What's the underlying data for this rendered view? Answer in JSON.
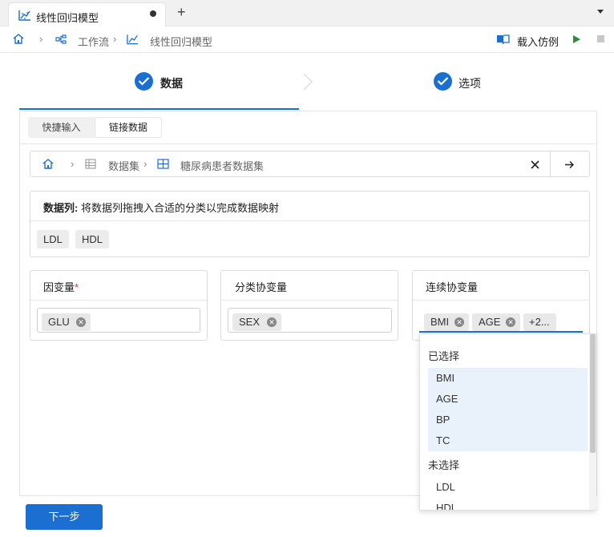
{
  "tab": {
    "title": "线性回归模型",
    "new_tab": "+"
  },
  "breadcrumb": {
    "workflow": "工作流",
    "model": "线性回归模型",
    "sep": "›",
    "load_example": "载入仿例"
  },
  "steps": [
    {
      "label": "数据"
    },
    {
      "label": "选项"
    }
  ],
  "segment": {
    "quick_input": "快捷输入",
    "link_data": "链接数据"
  },
  "path": {
    "sep": "›",
    "datasets": "数据集",
    "dataset_name": "糖尿病患者数据集"
  },
  "data_columns": {
    "title_bold": "数据列:",
    "title_rest": " 将数据列拖拽入合适的分类以完成数据映射",
    "items": [
      "LDL",
      "HDL"
    ]
  },
  "cards": {
    "dependent": {
      "title": "因变量",
      "required_mark": "*",
      "tags": [
        "GLU"
      ]
    },
    "categorical": {
      "title": "分类协变量",
      "tags": [
        "SEX"
      ]
    },
    "continuous": {
      "title": "连续协变量",
      "tags": [
        "BMI",
        "AGE"
      ],
      "more": "+2..."
    }
  },
  "dropdown": {
    "selected_heading": "已选择",
    "selected": [
      "BMI",
      "AGE",
      "BP",
      "TC"
    ],
    "unselected_heading": "未选择",
    "unselected": [
      "LDL",
      "HDL"
    ]
  },
  "next_button": "下一步",
  "colors": {
    "accent": "#1b6fd1",
    "run": "#2e8b3a",
    "required": "#d9363e",
    "selected_bg": "#e9f1fb"
  }
}
